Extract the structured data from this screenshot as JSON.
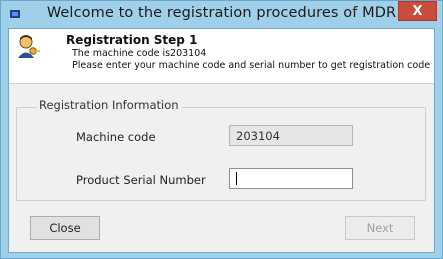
{
  "window": {
    "title": "Welcome to the registration procedures of MDR",
    "close_glyph": "X",
    "icons": {
      "app": "app-icon",
      "close": "close-icon"
    }
  },
  "header": {
    "step_title": "Registration Step 1",
    "line1": "The machine code is203104",
    "line2": "Please enter your machine code and serial number to get registration code",
    "icon": "user-key-icon"
  },
  "group": {
    "legend": "Registration Information",
    "machine_code_label": "Machine code",
    "machine_code_value": "203104",
    "serial_label": "Product Serial Number",
    "serial_value": ""
  },
  "buttons": {
    "close": "Close",
    "next": "Next"
  },
  "colors": {
    "titlebar": "#9fcfe9",
    "close_button": "#c94c3c",
    "client_bg": "#f0f0f0"
  }
}
